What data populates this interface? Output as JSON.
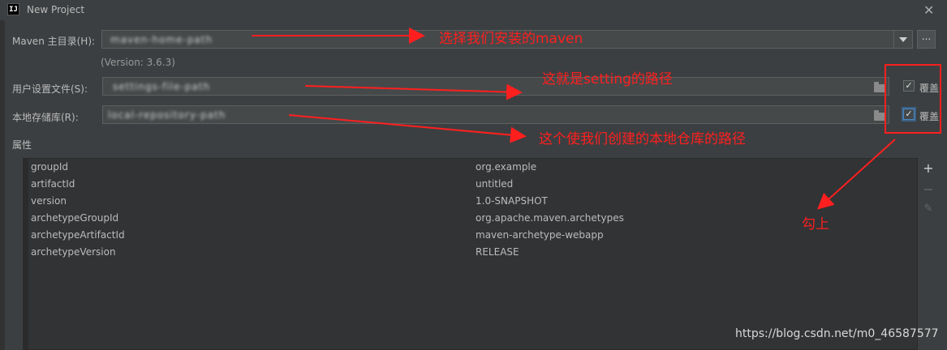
{
  "window": {
    "title": "New Project",
    "app_icon": "IJ"
  },
  "maven_home": {
    "label": "Maven 主目录(H):",
    "value": "maven-home-path",
    "version": "(Version: 3.6.3)"
  },
  "settings_file": {
    "label": "用户设置文件(S):",
    "value": "settings-file-path",
    "override_label": "覆盖",
    "override_checked": true
  },
  "local_repo": {
    "label": "本地存储库(R):",
    "value": "local-repository-path",
    "override_label": "覆盖",
    "override_checked": true
  },
  "properties": {
    "label": "属性",
    "rows": [
      {
        "key": "groupId",
        "value": "org.example"
      },
      {
        "key": "artifactId",
        "value": "untitled"
      },
      {
        "key": "version",
        "value": "1.0-SNAPSHOT"
      },
      {
        "key": "archetypeGroupId",
        "value": "org.apache.maven.archetypes"
      },
      {
        "key": "archetypeArtifactId",
        "value": "maven-archetype-webapp"
      },
      {
        "key": "archetypeVersion",
        "value": "RELEASE"
      }
    ]
  },
  "annotations": {
    "maven": "选择我们安装的maven",
    "settings": "这就是setting的路径",
    "repo": "这个使我们创建的本地仓库的路径",
    "check": "勾上"
  },
  "watermark": "https://blog.csdn.net/m0_46587577",
  "colors": {
    "annotation": "#ff1f1f",
    "background": "#3c3f41"
  }
}
